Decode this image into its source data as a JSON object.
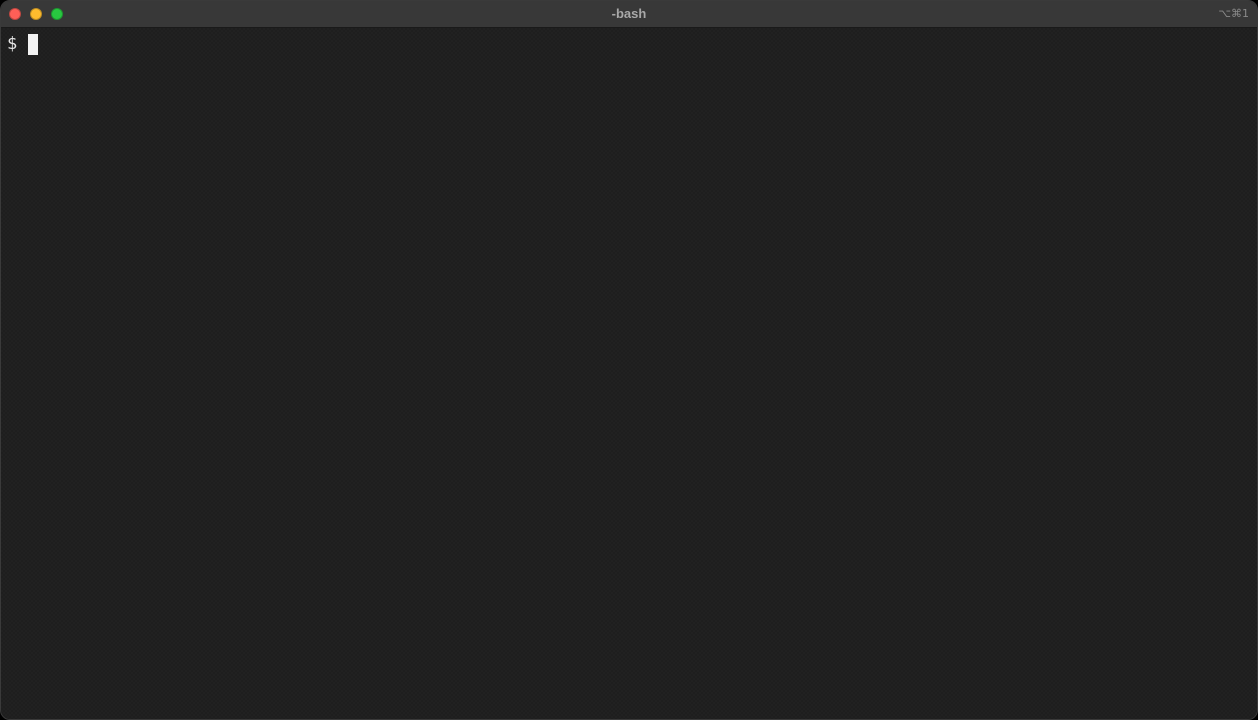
{
  "window": {
    "title": "-bash",
    "shortcut": "⌥⌘1",
    "controls": {
      "close_color": "#fe5f57",
      "minimize_color": "#febc2e",
      "zoom_color": "#28c840"
    }
  },
  "terminal": {
    "prompt": "$",
    "input": "",
    "background_color": "#1e1e1e",
    "text_color": "#e6e6e6",
    "cursor_color": "#f2f2f2"
  }
}
